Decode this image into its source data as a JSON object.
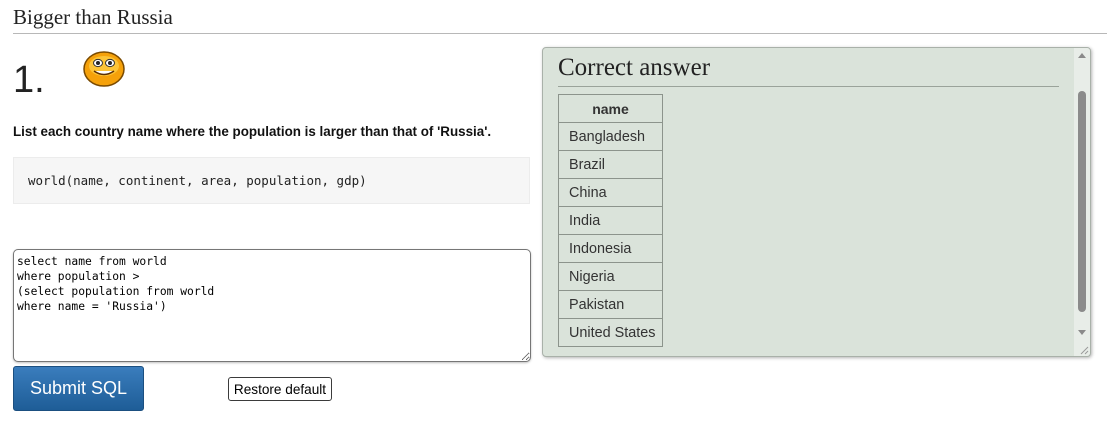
{
  "page": {
    "title": "Bigger than Russia"
  },
  "question": {
    "number": "1.",
    "status_icon": "smiley-face-icon",
    "text": "List each country name where the population is larger than that of 'Russia'.",
    "schema": "world(name, continent, area, population, gdp)"
  },
  "editor": {
    "sql": "select name from world\nwhere population >\n(select population from world\nwhere name = 'Russia')"
  },
  "buttons": {
    "submit_label": "Submit SQL",
    "restore_label": "Restore default"
  },
  "answer": {
    "heading": "Correct answer",
    "column_header": "name",
    "rows": [
      "Bangladesh",
      "Brazil",
      "China",
      "India",
      "Indonesia",
      "Nigeria",
      "Pakistan",
      "United States"
    ]
  },
  "colors": {
    "submit_button": "#2a6eac",
    "answer_panel_bg": "#dae3da",
    "schema_bg": "#f6f6f6"
  }
}
